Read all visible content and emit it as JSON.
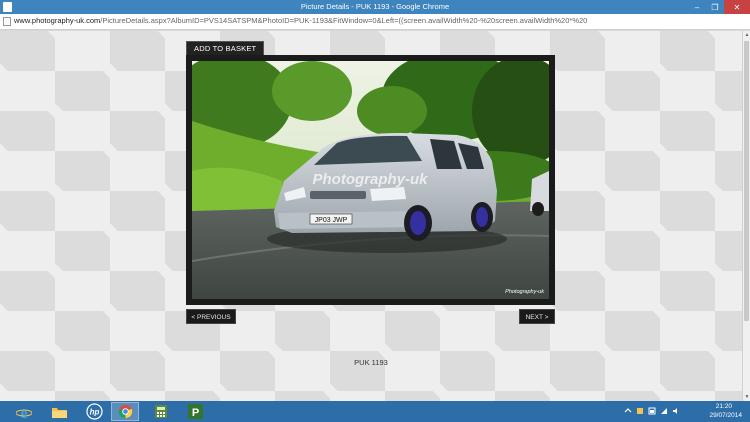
{
  "window": {
    "title": "Picture Details - PUK 1193 - Google Chrome",
    "controls": {
      "minimize": "–",
      "maximize": "❐",
      "close": "✕"
    }
  },
  "address_bar": {
    "url_host": "www.photography-uk.com",
    "url_rest": "/PictureDetails.aspx?AlbumID=PVS14SATSPM&PhotoID=PUK-1193&FitWindow=0&Left=((screen.availWidth%20-%20screen.availWidth%20*%20"
  },
  "page": {
    "add_to_basket_label": "ADD TO BASKET",
    "photo": {
      "watermark": "Photography-uk",
      "corner_mark": "Photography-uk",
      "plate": "JP03 JWP"
    },
    "previous_label": "< PREVIOUS",
    "next_label": "NEXT >",
    "caption": "PUK 1193"
  },
  "taskbar": {
    "apps": [
      {
        "name": "Internet Explorer",
        "icon": "internet-explorer-icon",
        "color": "#3aa0e8"
      },
      {
        "name": "File Explorer",
        "icon": "folder-icon",
        "color": "#f2c14e"
      },
      {
        "name": "HP",
        "icon": "hp-icon",
        "color": "#ffffff"
      },
      {
        "name": "Google Chrome",
        "icon": "chrome-icon",
        "color": "#dd4b39"
      },
      {
        "name": "Calculator",
        "icon": "calculator-icon",
        "color": "#8bc34a"
      },
      {
        "name": "Microsoft Project",
        "icon": "project-icon",
        "color": "#31752f"
      }
    ],
    "tray": {
      "time": "21:20",
      "date": "29/07/2014"
    }
  }
}
